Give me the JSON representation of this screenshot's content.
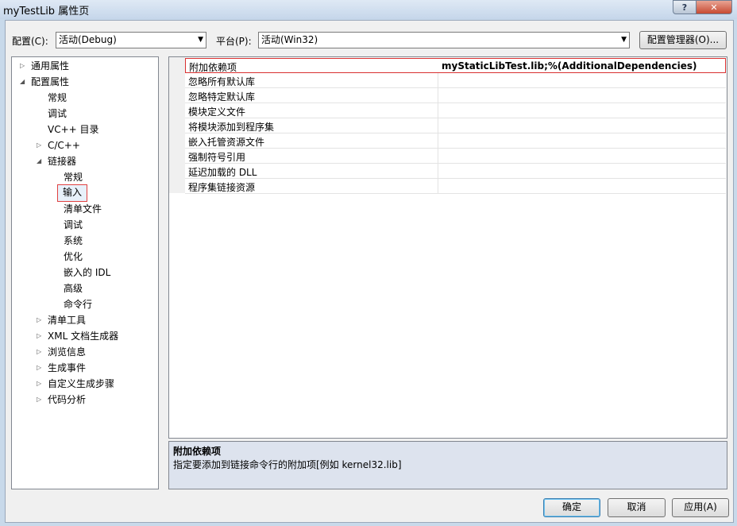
{
  "window": {
    "title": "myTestLib 属性页",
    "help": "?",
    "close": "✕"
  },
  "toolbar": {
    "config_label": "配置(C):",
    "config_value": "活动(Debug)",
    "platform_label": "平台(P):",
    "platform_value": "活动(Win32)",
    "config_manager": "配置管理器(O)..."
  },
  "tree": {
    "items": [
      {
        "label": "通用属性",
        "expander": "▷"
      },
      {
        "label": "配置属性",
        "expander": "◢"
      },
      {
        "label": "常规"
      },
      {
        "label": "调试"
      },
      {
        "label": "VC++ 目录"
      },
      {
        "label": "C/C++",
        "expander": "▷"
      },
      {
        "label": "链接器",
        "expander": "◢"
      },
      {
        "label": "常规"
      },
      {
        "label": "输入"
      },
      {
        "label": "清单文件"
      },
      {
        "label": "调试"
      },
      {
        "label": "系统"
      },
      {
        "label": "优化"
      },
      {
        "label": "嵌入的 IDL"
      },
      {
        "label": "高级"
      },
      {
        "label": "命令行"
      },
      {
        "label": "清单工具",
        "expander": "▷"
      },
      {
        "label": "XML 文档生成器",
        "expander": "▷"
      },
      {
        "label": "浏览信息",
        "expander": "▷"
      },
      {
        "label": "生成事件",
        "expander": "▷"
      },
      {
        "label": "自定义生成步骤",
        "expander": "▷"
      },
      {
        "label": "代码分析",
        "expander": "▷"
      }
    ]
  },
  "grid": {
    "rows": [
      {
        "name": "附加依赖项",
        "value": "myStaticLibTest.lib;%(AdditionalDependencies)"
      },
      {
        "name": "忽略所有默认库",
        "value": ""
      },
      {
        "name": "忽略特定默认库",
        "value": ""
      },
      {
        "name": "模块定义文件",
        "value": ""
      },
      {
        "name": "将模块添加到程序集",
        "value": ""
      },
      {
        "name": "嵌入托管资源文件",
        "value": ""
      },
      {
        "name": "强制符号引用",
        "value": ""
      },
      {
        "name": "延迟加载的 DLL",
        "value": ""
      },
      {
        "name": "程序集链接资源",
        "value": ""
      }
    ]
  },
  "description": {
    "title": "附加依赖项",
    "text": "指定要添加到链接命令行的附加项[例如 kernel32.lib]"
  },
  "buttons": {
    "ok": "确定",
    "cancel": "取消",
    "apply": "应用(A)"
  }
}
